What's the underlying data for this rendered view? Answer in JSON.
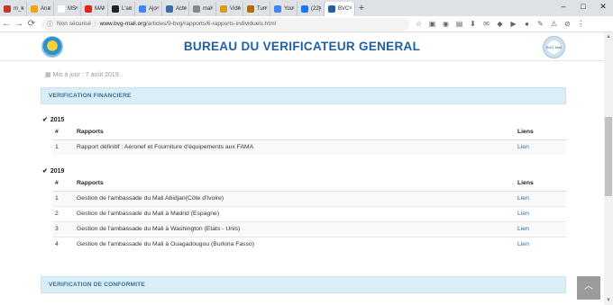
{
  "browser": {
    "tabs": [
      {
        "label": "m_k",
        "color": "#c0392b"
      },
      {
        "label": "Ana",
        "color": "#f0a30a"
      },
      {
        "label": "MS",
        "color": "#ffffff"
      },
      {
        "label": "MAI",
        "color": "#e62117"
      },
      {
        "label": "L'ac",
        "color": "#222222"
      },
      {
        "label": "Ajo",
        "color": "#4285f4"
      },
      {
        "label": "Acte",
        "color": "#3b6ea5"
      },
      {
        "label": "mal",
        "color": "#888888"
      },
      {
        "label": "Vidé",
        "color": "#d4a017"
      },
      {
        "label": "Tun",
        "color": "#b36b00"
      },
      {
        "label": "You",
        "color": "#4285f4"
      },
      {
        "label": "(22)",
        "color": "#1877f2"
      },
      {
        "label": "BVC",
        "color": "#1f5fa5"
      }
    ],
    "active_tab_index": 12,
    "new_tab": "+",
    "window_controls": [
      "–",
      "□",
      "✕"
    ],
    "security_text": "Non sécurisé",
    "url_host": "www.bvg-mali.org",
    "url_path": "/articles/9-bvg/rapports/6-rapports-individuels.html"
  },
  "header": {
    "title": "BUREAU DU VERIFICATEUR GENERAL",
    "logo_right_text": "BVG-Mali"
  },
  "page": {
    "updated": "Mis à jour : 7 août 2019",
    "section1_title": "VERIFICATION FINANCIERE",
    "section2_title": "VERIFICATION DE CONFORMITE",
    "col_num": "#",
    "col_reports": "Rapports",
    "col_links": "Liens",
    "year1": "2015",
    "year2": "2019",
    "rows_2015": [
      {
        "num": "1",
        "report": "Rapport définitif : Aéronef et Fourniture d'équipements aux FAMA",
        "link": "Lien"
      }
    ],
    "rows_2019": [
      {
        "num": "1",
        "report": "Gestion de l'ambassade du Mali Abidjan(Côte d'Ivoire)",
        "link": "Lien"
      },
      {
        "num": "2",
        "report": "Gestion de l'ambassade du Mali à Madrid (Espagne)",
        "link": "Lien"
      },
      {
        "num": "3",
        "report": "Gestion de l'ambassade du Mali à Washington (Etats - Unis)",
        "link": "Lien"
      },
      {
        "num": "4",
        "report": "Gestion de l'ambassade du Mali à Ouagadougou (Burkina Fasso)",
        "link": "Lien"
      }
    ]
  }
}
